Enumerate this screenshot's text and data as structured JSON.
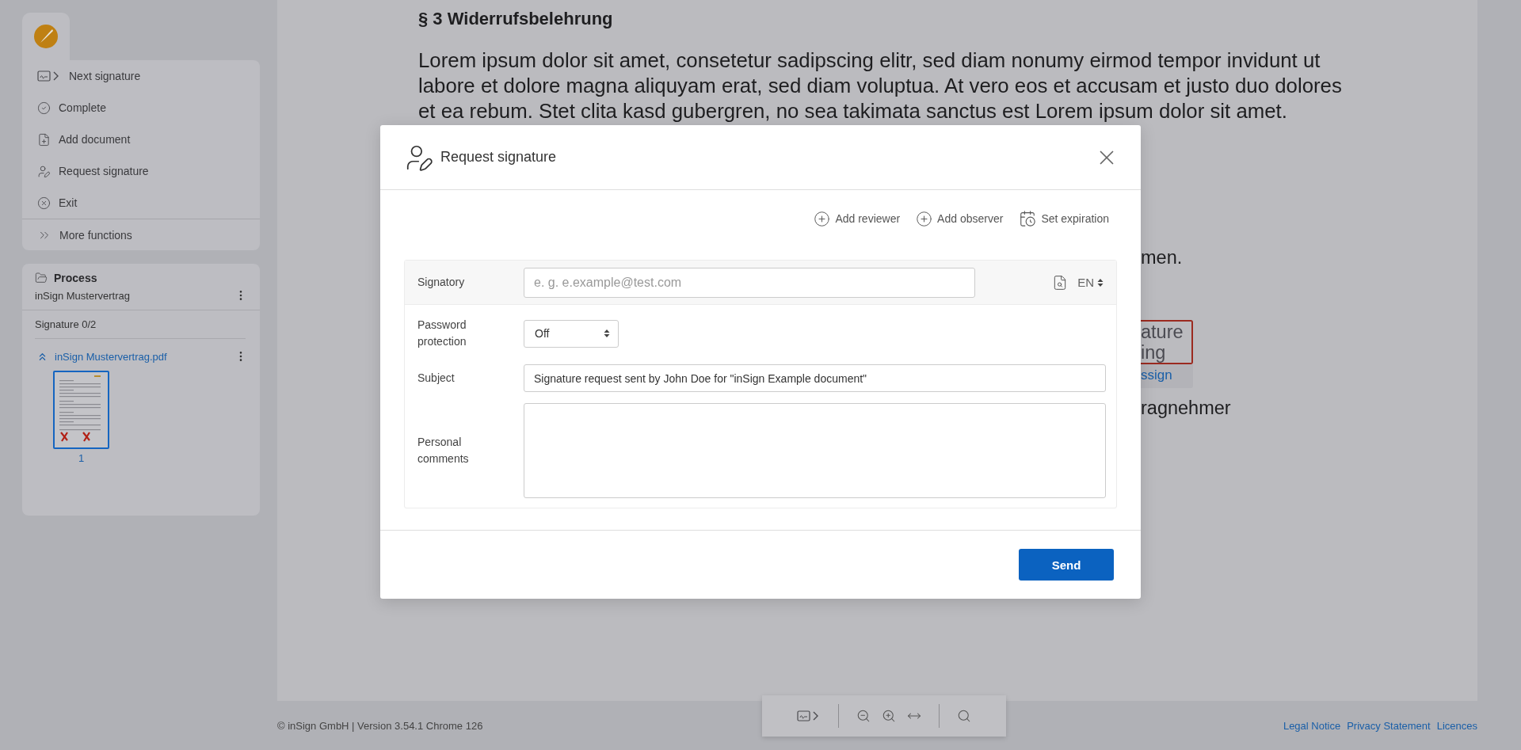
{
  "sidebar": {
    "menu": [
      {
        "kind": "next-signature",
        "label": "Next signature"
      },
      {
        "kind": "complete",
        "label": "Complete"
      },
      {
        "kind": "add-document",
        "label": "Add document"
      },
      {
        "kind": "request-signature",
        "label": "Request signature"
      },
      {
        "kind": "exit",
        "label": "Exit"
      }
    ],
    "more": {
      "label": "More functions"
    },
    "process": {
      "title": "Process",
      "name": "inSign Mustervertrag",
      "signatures": "Signature 0/2",
      "document": {
        "name": "inSign Mustervertrag.pdf",
        "expanded": true,
        "pages": [
          {
            "number": "1",
            "selected": true
          }
        ]
      }
    }
  },
  "document": {
    "heading": "§ 3 Widerrufsbelehrung",
    "lines": [
      "Lorem ipsum dolor sit amet, consetetur sadipscing elitr, sed diam nonumy eirmod tempor invidunt ut",
      "labore et dolore magna aliquyam erat, sed diam voluptua. At vero eos et accusam et justo duo dolores",
      "et ea rebum. Stet clita kasd gubergren, no sea takimata sanctus est Lorem ipsum dolor sit amet."
    ],
    "fragments": [
      {
        "kind": "text",
        "text": "men."
      },
      {
        "kind": "field",
        "lines": [
          "ature",
          "ing"
        ]
      },
      {
        "kind": "link",
        "text": "ssign"
      },
      {
        "kind": "text",
        "text": "ragnehmer"
      }
    ]
  },
  "dialog": {
    "title": "Request signature",
    "actions": [
      {
        "kind": "add",
        "label": "Add reviewer"
      },
      {
        "kind": "add",
        "label": "Add observer"
      },
      {
        "kind": "calendar",
        "label": "Set expiration"
      }
    ],
    "signatory": {
      "label": "Signatory",
      "placeholder": "e. g. e.example@test.com",
      "language": "EN"
    },
    "password": {
      "label": "Password protection",
      "value": "Off"
    },
    "subject": {
      "label": "Subject",
      "value": "Signature request sent by John Doe for \"inSign Example document\""
    },
    "comments": {
      "label": "Personal comments"
    },
    "send": "Send"
  },
  "toolbar": [
    {
      "kind": "next-signature"
    },
    {
      "kind": "divider"
    },
    {
      "kind": "zoom-out"
    },
    {
      "kind": "zoom-in"
    },
    {
      "kind": "fit-width"
    },
    {
      "kind": "divider"
    },
    {
      "kind": "zoom-search"
    }
  ],
  "footer": {
    "copyright": "© inSign GmbH | Version 3.54.1 Chrome 126",
    "links": [
      "Legal Notice",
      "Privacy Statement",
      "Licences"
    ]
  }
}
